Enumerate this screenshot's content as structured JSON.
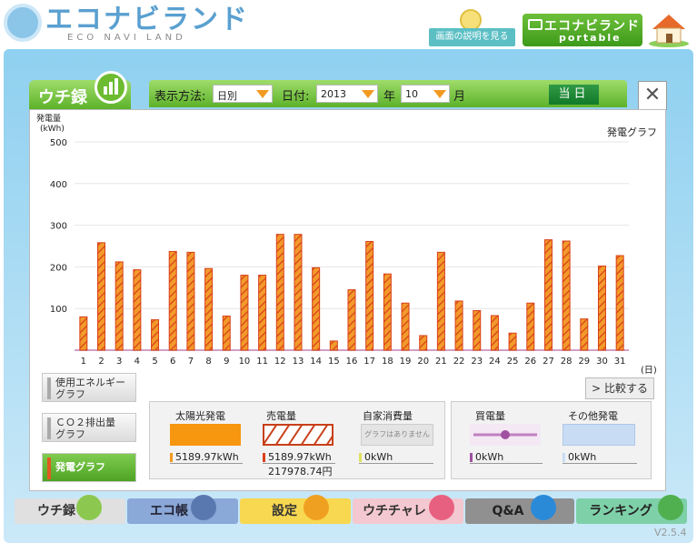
{
  "header": {
    "logo_title": "エコナビランド",
    "logo_sub": "ECO NAVI LAND",
    "help_label": "画面の説明を見る",
    "portable_title": "エコナビランド",
    "portable_sub": "portable"
  },
  "tab": {
    "label": "ウチ録"
  },
  "toolbar": {
    "display_label": "表示方法:",
    "display_value": "日別",
    "date_label": "日付:",
    "year_value": "2013",
    "year_label": "年",
    "month_value": "10",
    "month_label": "月",
    "today_label": "当日",
    "close_label": "✕"
  },
  "chart_data": {
    "type": "bar",
    "title": "発電グラフ",
    "ylabel": "発電量\n(kWh)",
    "xlabel": "(日)",
    "ylim": [
      0,
      500
    ],
    "yticks": [
      100,
      200,
      300,
      400,
      500
    ],
    "categories": [
      "1",
      "2",
      "3",
      "4",
      "5",
      "6",
      "7",
      "8",
      "9",
      "10",
      "11",
      "12",
      "13",
      "14",
      "15",
      "16",
      "17",
      "18",
      "19",
      "20",
      "21",
      "22",
      "23",
      "24",
      "25",
      "26",
      "27",
      "28",
      "29",
      "30",
      "31"
    ],
    "values": [
      80,
      258,
      212,
      193,
      73,
      237,
      235,
      196,
      82,
      180,
      180,
      278,
      278,
      198,
      22,
      145,
      261,
      183,
      113,
      35,
      235,
      118,
      95,
      83,
      41,
      113,
      265,
      262,
      75,
      202,
      227
    ],
    "bar_color": "#f08a1a",
    "hatch_color": "#d8401a"
  },
  "side_buttons": [
    {
      "label": "使用エネルギー\nグラフ"
    },
    {
      "label": "ＣＯ２排出量\nグラフ"
    },
    {
      "label": "発電グラフ"
    }
  ],
  "compare_label": "比較する",
  "legend": {
    "solar_title": "太陽光発電",
    "solar_value": "5189.97kWh",
    "sell_title": "売電量",
    "sell_value": "5189.97kWh",
    "sell_yen": "217978.74円",
    "self_title": "自家消費量",
    "self_placeholder": "グラフはありません",
    "self_value": "0kWh",
    "buy_title": "買電量",
    "buy_value": "0kWh",
    "other_title": "その他発電",
    "other_value": "0kWh"
  },
  "nav": [
    {
      "label": "ウチ録"
    },
    {
      "label": "エコ帳"
    },
    {
      "label": "設定"
    },
    {
      "label": "ウチチャレ"
    },
    {
      "label": "Q&A"
    },
    {
      "label": "ランキング"
    }
  ],
  "version": "V2.5.4"
}
